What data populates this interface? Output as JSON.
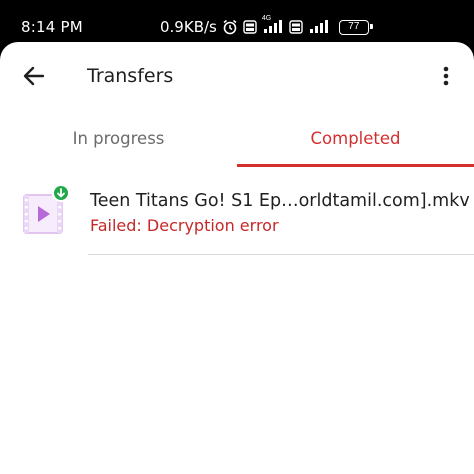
{
  "status_bar": {
    "time": "8:14 PM",
    "network_speed": "0.9KB/s",
    "network_type": "4G",
    "volte_label": "Vo LTE",
    "battery": "77",
    "icons": [
      "alarm-icon",
      "volte-icon",
      "signal-icon",
      "battery-icon"
    ]
  },
  "appbar": {
    "title": "Transfers",
    "back_icon": "arrow-back-icon",
    "more_icon": "more-vert-icon"
  },
  "tabs": [
    {
      "label": "In progress",
      "selected": false
    },
    {
      "label": "Completed",
      "selected": true
    }
  ],
  "transfers": [
    {
      "name": "Teen Titans Go! S1 Ep…orldtamil.com].mkv",
      "status": "Failed: Decryption error",
      "icon": "video-file-icon",
      "badge_icon": "download-badge-icon"
    }
  ],
  "colors": {
    "accent": "#d32f2f",
    "error": "#c62828",
    "badge": "#22a84a",
    "video_file": "#b56ad8"
  }
}
